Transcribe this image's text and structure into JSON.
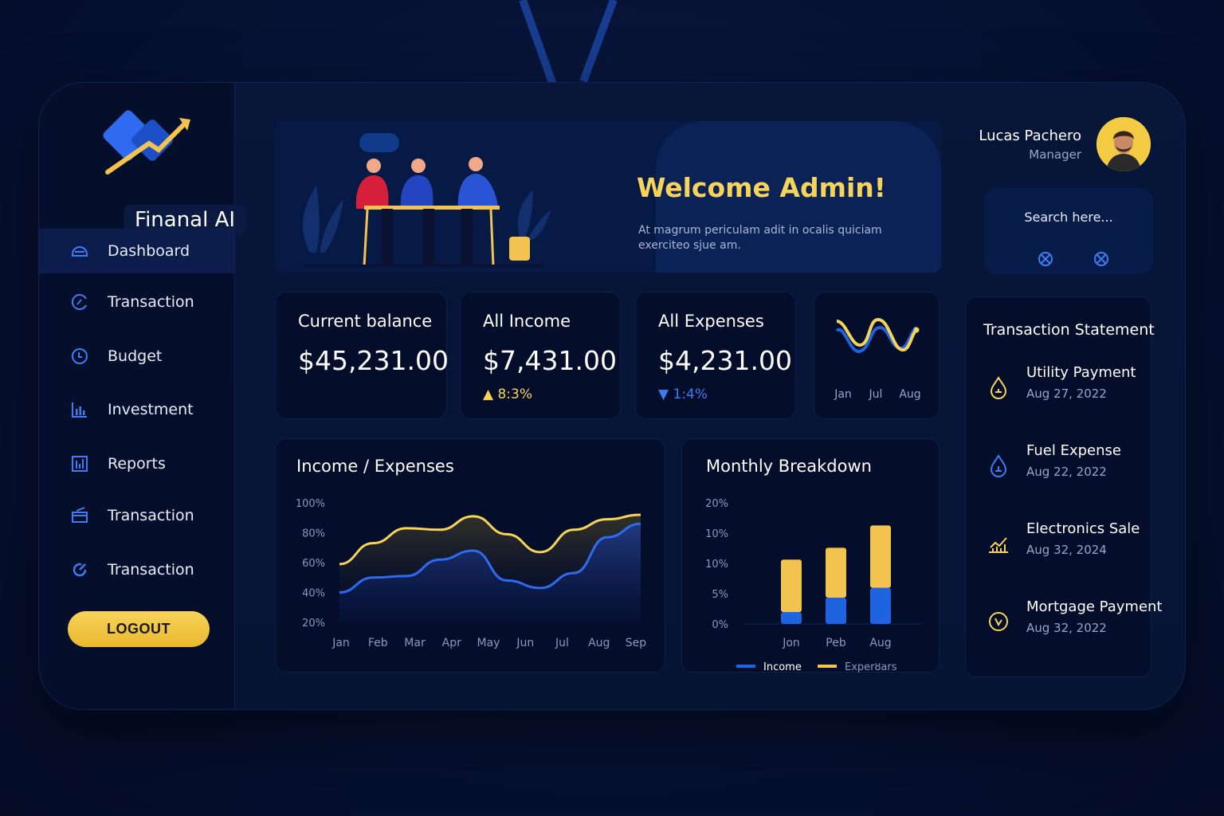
{
  "app": {
    "name": "Finanal AI"
  },
  "sidebar": {
    "items": [
      {
        "label": "Dashboard",
        "icon": "dashboard-icon",
        "active": true
      },
      {
        "label": "Transaction",
        "icon": "transaction-icon"
      },
      {
        "label": "Budget",
        "icon": "clock-icon"
      },
      {
        "label": "Investment",
        "icon": "bar-chart-icon"
      },
      {
        "label": "Reports",
        "icon": "reports-icon"
      },
      {
        "label": "Transaction",
        "icon": "card-icon"
      },
      {
        "label": "Transaction",
        "icon": "refresh-icon"
      }
    ],
    "logout_label": "LOGOUT"
  },
  "hero": {
    "title": "Welcome Admin!",
    "subtitle": "At magrum periculam adit in ocalis quiciam exerciteo sjue am."
  },
  "profile": {
    "name": "Lucas Pachero",
    "role": "Manager"
  },
  "search": {
    "placeholder": "Search here..."
  },
  "stats": [
    {
      "label": "Current balance",
      "value": "$45,231.00"
    },
    {
      "label": "All Income",
      "value": "$7,431.00",
      "change": "8:3%",
      "direction": "up"
    },
    {
      "label": "All Expenses",
      "value": "$4,231.00",
      "change": "1:4%",
      "direction": "down"
    }
  ],
  "mini_chart": {
    "x_labels": [
      "Jan",
      "Jul",
      "Aug"
    ]
  },
  "colors": {
    "gold": "#f6d45a",
    "blue": "#2f6bf0",
    "background": "#061434"
  },
  "statement": {
    "title": "Transaction Statement",
    "items": [
      {
        "title": "Utility Payment",
        "date": "Aug 27, 2022",
        "icon": "drop-icon"
      },
      {
        "title": "Fuel Expense",
        "date": "Aug 22, 2022",
        "icon": "fuel-drop-icon"
      },
      {
        "title": "Electronics Sale",
        "date": "Aug 32, 2024",
        "icon": "growth-chart-icon"
      },
      {
        "title": "Mortgage Payment",
        "date": "Aug 32, 2022",
        "icon": "coin-icon"
      }
    ]
  },
  "chart_data": [
    {
      "type": "area",
      "title": "Income / Expenses",
      "categories": [
        "Jan",
        "Feb",
        "Mar",
        "Apr",
        "May",
        "Jun",
        "Jul",
        "Aug",
        "Sep"
      ],
      "y_ticks": [
        "100%",
        "80%",
        "60%",
        "40%",
        "20%"
      ],
      "ylim": [
        20,
        100
      ],
      "series": [
        {
          "color": "#f6d45a",
          "values": [
            59,
            73,
            83,
            82,
            91,
            79,
            67,
            82,
            89,
            92
          ]
        },
        {
          "color": "#2f6bf0",
          "values": [
            40,
            50,
            51,
            62,
            68,
            48,
            43,
            53,
            77,
            86
          ]
        }
      ],
      "grid": false
    },
    {
      "type": "bar",
      "title": "Monthly Breakdown",
      "categories": [
        "Jon",
        "Peb",
        "Aug"
      ],
      "y_ticks": [
        "20%",
        "10%",
        "10%",
        "5%",
        "0%"
      ],
      "series": [
        {
          "name": "Income",
          "color": "#1e63e0",
          "values": [
            1.8,
            4.0,
            5.5
          ]
        },
        {
          "name": "Experȣars",
          "color": "#f2c44f",
          "values": [
            8.0,
            7.6,
            9.5
          ]
        }
      ],
      "stacked": true,
      "legend": "bottom"
    }
  ]
}
